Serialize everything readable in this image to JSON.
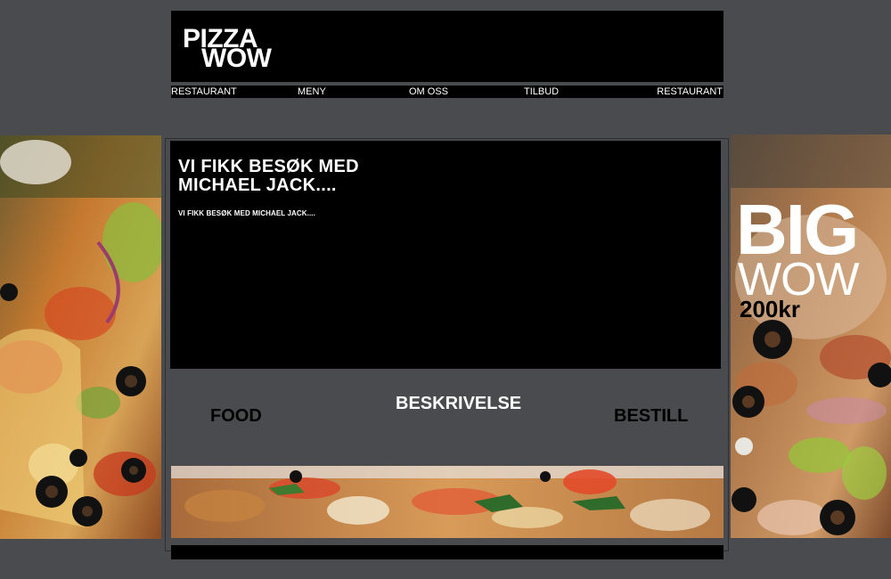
{
  "logo": {
    "line1": "PIZZA",
    "line2": "WOW"
  },
  "nav": {
    "items": [
      {
        "label": "RESTAURANT"
      },
      {
        "label": "MENY"
      },
      {
        "label": "OM OSS"
      },
      {
        "label": "TILBUD"
      },
      {
        "label": "RESTAURANT"
      }
    ]
  },
  "article": {
    "title": "VI FIKK BESØK MED MICHAEL JACK....",
    "body": "VI FIKK BESØK MED MICHAEL JACK...."
  },
  "promo": {
    "big": "BIG",
    "wow": "WOW",
    "price": "200kr"
  },
  "links": {
    "food": "FOOD",
    "beskrivelse": "BESKRIVELSE",
    "bestill": "BESTILL"
  },
  "colors": {
    "page_bg": "#4a4b4e",
    "panel_bg": "#000000",
    "text_light": "#ffffff",
    "text_dark": "#000000"
  }
}
